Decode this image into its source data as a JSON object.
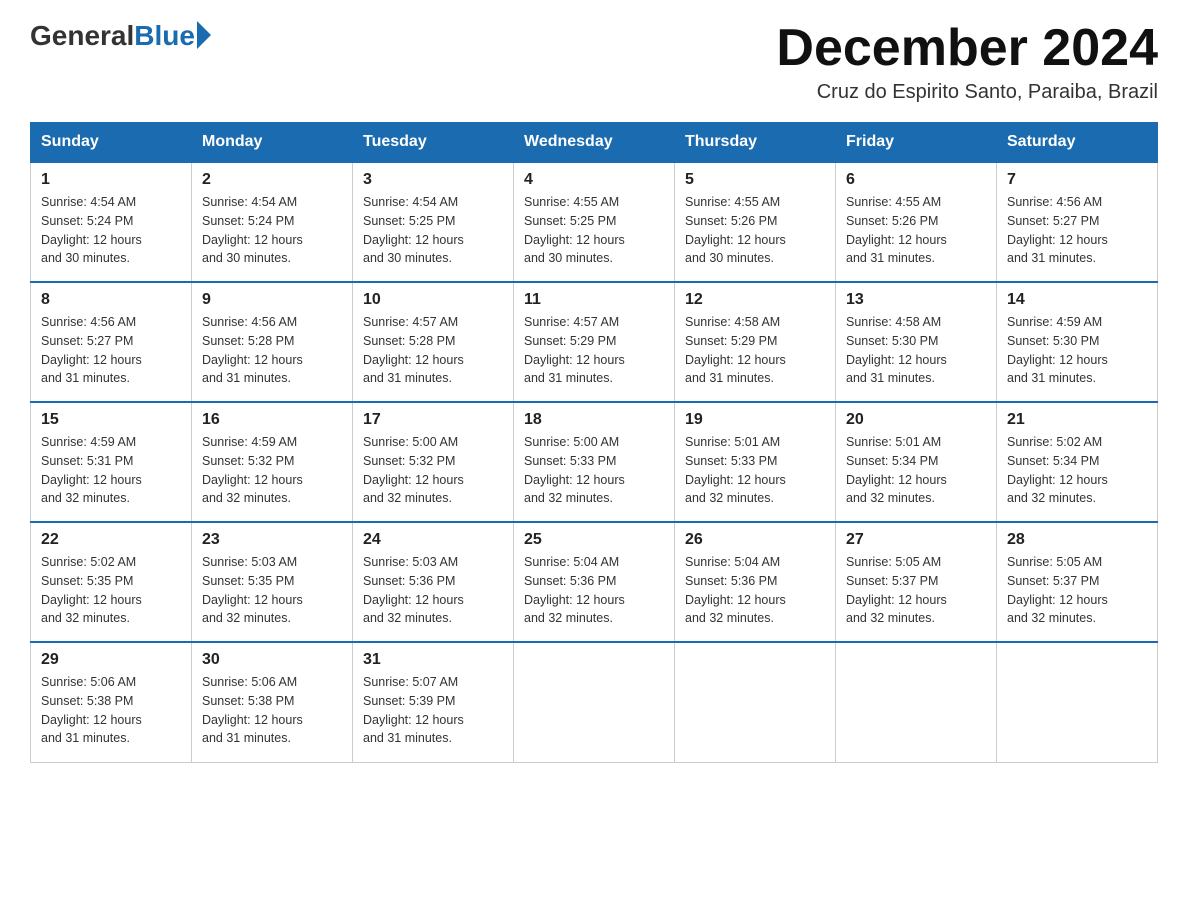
{
  "logo": {
    "general": "General",
    "blue": "Blue"
  },
  "title": "December 2024",
  "location": "Cruz do Espirito Santo, Paraiba, Brazil",
  "days_of_week": [
    "Sunday",
    "Monday",
    "Tuesday",
    "Wednesday",
    "Thursday",
    "Friday",
    "Saturday"
  ],
  "weeks": [
    [
      {
        "day": "1",
        "sunrise": "4:54 AM",
        "sunset": "5:24 PM",
        "daylight": "12 hours and 30 minutes."
      },
      {
        "day": "2",
        "sunrise": "4:54 AM",
        "sunset": "5:24 PM",
        "daylight": "12 hours and 30 minutes."
      },
      {
        "day": "3",
        "sunrise": "4:54 AM",
        "sunset": "5:25 PM",
        "daylight": "12 hours and 30 minutes."
      },
      {
        "day": "4",
        "sunrise": "4:55 AM",
        "sunset": "5:25 PM",
        "daylight": "12 hours and 30 minutes."
      },
      {
        "day": "5",
        "sunrise": "4:55 AM",
        "sunset": "5:26 PM",
        "daylight": "12 hours and 30 minutes."
      },
      {
        "day": "6",
        "sunrise": "4:55 AM",
        "sunset": "5:26 PM",
        "daylight": "12 hours and 31 minutes."
      },
      {
        "day": "7",
        "sunrise": "4:56 AM",
        "sunset": "5:27 PM",
        "daylight": "12 hours and 31 minutes."
      }
    ],
    [
      {
        "day": "8",
        "sunrise": "4:56 AM",
        "sunset": "5:27 PM",
        "daylight": "12 hours and 31 minutes."
      },
      {
        "day": "9",
        "sunrise": "4:56 AM",
        "sunset": "5:28 PM",
        "daylight": "12 hours and 31 minutes."
      },
      {
        "day": "10",
        "sunrise": "4:57 AM",
        "sunset": "5:28 PM",
        "daylight": "12 hours and 31 minutes."
      },
      {
        "day": "11",
        "sunrise": "4:57 AM",
        "sunset": "5:29 PM",
        "daylight": "12 hours and 31 minutes."
      },
      {
        "day": "12",
        "sunrise": "4:58 AM",
        "sunset": "5:29 PM",
        "daylight": "12 hours and 31 minutes."
      },
      {
        "day": "13",
        "sunrise": "4:58 AM",
        "sunset": "5:30 PM",
        "daylight": "12 hours and 31 minutes."
      },
      {
        "day": "14",
        "sunrise": "4:59 AM",
        "sunset": "5:30 PM",
        "daylight": "12 hours and 31 minutes."
      }
    ],
    [
      {
        "day": "15",
        "sunrise": "4:59 AM",
        "sunset": "5:31 PM",
        "daylight": "12 hours and 32 minutes."
      },
      {
        "day": "16",
        "sunrise": "4:59 AM",
        "sunset": "5:32 PM",
        "daylight": "12 hours and 32 minutes."
      },
      {
        "day": "17",
        "sunrise": "5:00 AM",
        "sunset": "5:32 PM",
        "daylight": "12 hours and 32 minutes."
      },
      {
        "day": "18",
        "sunrise": "5:00 AM",
        "sunset": "5:33 PM",
        "daylight": "12 hours and 32 minutes."
      },
      {
        "day": "19",
        "sunrise": "5:01 AM",
        "sunset": "5:33 PM",
        "daylight": "12 hours and 32 minutes."
      },
      {
        "day": "20",
        "sunrise": "5:01 AM",
        "sunset": "5:34 PM",
        "daylight": "12 hours and 32 minutes."
      },
      {
        "day": "21",
        "sunrise": "5:02 AM",
        "sunset": "5:34 PM",
        "daylight": "12 hours and 32 minutes."
      }
    ],
    [
      {
        "day": "22",
        "sunrise": "5:02 AM",
        "sunset": "5:35 PM",
        "daylight": "12 hours and 32 minutes."
      },
      {
        "day": "23",
        "sunrise": "5:03 AM",
        "sunset": "5:35 PM",
        "daylight": "12 hours and 32 minutes."
      },
      {
        "day": "24",
        "sunrise": "5:03 AM",
        "sunset": "5:36 PM",
        "daylight": "12 hours and 32 minutes."
      },
      {
        "day": "25",
        "sunrise": "5:04 AM",
        "sunset": "5:36 PM",
        "daylight": "12 hours and 32 minutes."
      },
      {
        "day": "26",
        "sunrise": "5:04 AM",
        "sunset": "5:36 PM",
        "daylight": "12 hours and 32 minutes."
      },
      {
        "day": "27",
        "sunrise": "5:05 AM",
        "sunset": "5:37 PM",
        "daylight": "12 hours and 32 minutes."
      },
      {
        "day": "28",
        "sunrise": "5:05 AM",
        "sunset": "5:37 PM",
        "daylight": "12 hours and 32 minutes."
      }
    ],
    [
      {
        "day": "29",
        "sunrise": "5:06 AM",
        "sunset": "5:38 PM",
        "daylight": "12 hours and 31 minutes."
      },
      {
        "day": "30",
        "sunrise": "5:06 AM",
        "sunset": "5:38 PM",
        "daylight": "12 hours and 31 minutes."
      },
      {
        "day": "31",
        "sunrise": "5:07 AM",
        "sunset": "5:39 PM",
        "daylight": "12 hours and 31 minutes."
      },
      null,
      null,
      null,
      null
    ]
  ],
  "labels": {
    "sunrise": "Sunrise:",
    "sunset": "Sunset:",
    "daylight": "Daylight:"
  }
}
